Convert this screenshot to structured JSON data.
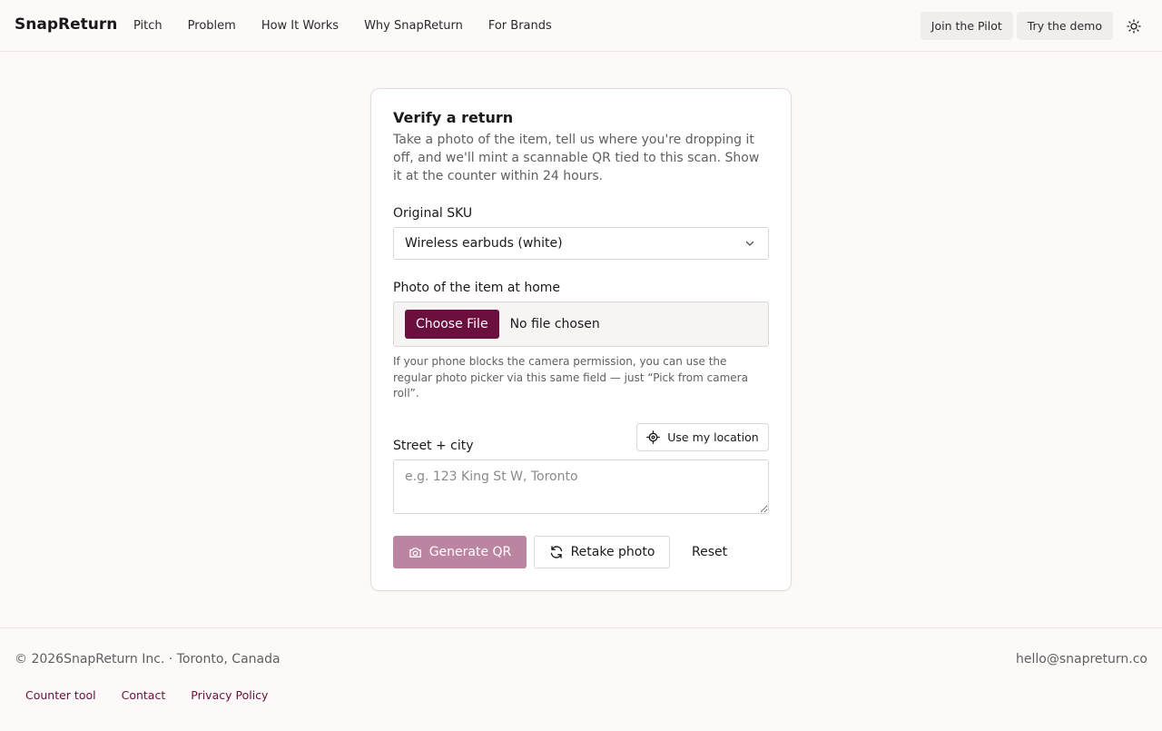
{
  "header": {
    "brand": "SnapReturn",
    "nav": [
      "Pitch",
      "Problem",
      "How It Works",
      "Why SnapReturn",
      "For Brands"
    ],
    "join_pilot": "Join the Pilot",
    "try_demo": "Try the demo",
    "theme_icon": "sun-icon"
  },
  "form": {
    "title": "Verify a return",
    "description": "Take a photo of the item, tell us where you're dropping it off, and we'll mint a scannable QR tied to this scan. Show it at the counter within 24 hours.",
    "sku_label": "Original SKU",
    "sku_value": "Wireless earbuds (white)",
    "photo_label": "Photo of the item at home",
    "choose_file": "Choose File",
    "no_file": "No file chosen",
    "photo_hint": "If your phone blocks the camera permission, you can use the regular photo picker via this same field — just “Pick from camera roll”.",
    "address_label": "Street + city",
    "use_location": "Use my location",
    "address_placeholder": "e.g. 123 King St W, Toronto",
    "address_value": "",
    "generate_qr": "Generate QR",
    "retake_photo": "Retake photo",
    "reset": "Reset"
  },
  "footer": {
    "copyright": "© 2026SnapReturn Inc. · Toronto, Canada",
    "email": "hello@snapreturn.co",
    "links": [
      "Counter tool",
      "Contact",
      "Privacy Policy"
    ]
  },
  "colors": {
    "accent": "#6a0f3e",
    "accent_disabled": "#bb84a1",
    "background": "#fdf9f9"
  }
}
